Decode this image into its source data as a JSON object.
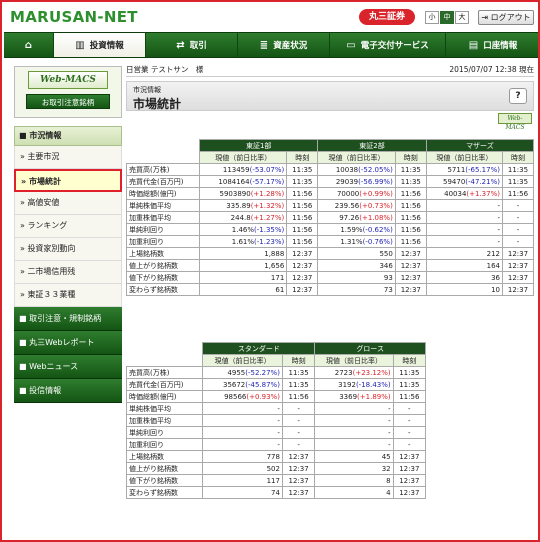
{
  "header": {
    "logo": "MARUSAN-NET",
    "brand": "丸三証券",
    "font_sizes": [
      "小",
      "中",
      "大"
    ],
    "logout": "ログアウト"
  },
  "nav": [
    {
      "label": "",
      "icon": "home-icon"
    },
    {
      "label": "投資情報",
      "icon": "chart-icon"
    },
    {
      "label": "取引",
      "icon": "trade-arrows-icon"
    },
    {
      "label": "資産状況",
      "icon": "database-icon"
    },
    {
      "label": "電子交付サービス",
      "icon": "monitor-icon"
    },
    {
      "label": "口座情報",
      "icon": "account-icon"
    }
  ],
  "sidebar": {
    "webmacs_logo": "Web-MACS",
    "webmacs_button": "お取引注意銘柄",
    "section": "市況情報",
    "items": [
      "主要市況",
      "市場統計",
      "高値安値",
      "ランキング",
      "投資家別動向",
      "二市場信用残",
      "東証３３業種"
    ],
    "selected": "市場統計",
    "dark_items": [
      "取引注意・規制銘柄",
      "丸三Webレポート",
      "Webニュース",
      "投信情報"
    ]
  },
  "main": {
    "user_prefix": "日営業",
    "user_name": "テストサン　様",
    "datetime": "2015/07/07 12:38 現在",
    "title_sub": "市況情報",
    "title": "市場統計",
    "help": "?",
    "webmacs_small": "Web-MACS",
    "col_current": "現値（前日比率）",
    "col_time": "時刻"
  },
  "table1": {
    "groups": [
      "東証1部",
      "東証2部",
      "マザーズ"
    ],
    "rows": [
      {
        "label": "売買高(万株)",
        "cells": [
          [
            "113459",
            "(-53.07%)",
            "neg",
            "11:35"
          ],
          [
            "10038",
            "(-52.05%)",
            "neg",
            "11:35"
          ],
          [
            "5711",
            "(-65.17%)",
            "neg",
            "11:35"
          ]
        ]
      },
      {
        "label": "売買代金(百万円)",
        "cells": [
          [
            "1084164",
            "(-57.17%)",
            "neg",
            "11:35"
          ],
          [
            "29039",
            "(-56.99%)",
            "neg",
            "11:35"
          ],
          [
            "59470",
            "(-47.21%)",
            "neg",
            "11:35"
          ]
        ]
      },
      {
        "label": "時価総額(億円)",
        "cells": [
          [
            "5903890",
            "(+1.28%)",
            "pos",
            "11:56"
          ],
          [
            "70000",
            "(+0.99%)",
            "pos",
            "11:56"
          ],
          [
            "40034",
            "(+1.37%)",
            "pos",
            "11:56"
          ]
        ]
      },
      {
        "label": "単純株価平均",
        "cells": [
          [
            "335.89",
            "(+1.32%)",
            "pos",
            "11:56"
          ],
          [
            "239.56",
            "(+0.73%)",
            "pos",
            "11:56"
          ],
          [
            "-",
            "",
            "",
            "-"
          ]
        ]
      },
      {
        "label": "加重株価平均",
        "cells": [
          [
            "244.8",
            "(+1.27%)",
            "pos",
            "11:56"
          ],
          [
            "97.26",
            "(+1.08%)",
            "pos",
            "11:56"
          ],
          [
            "-",
            "",
            "",
            "-"
          ]
        ]
      },
      {
        "label": "単純利回り",
        "cells": [
          [
            "1.46%",
            "(-1.35%)",
            "neg",
            "11:56"
          ],
          [
            "1.59%",
            "(-0.62%)",
            "neg",
            "11:56"
          ],
          [
            "-",
            "",
            "",
            "-"
          ]
        ]
      },
      {
        "label": "加重利回り",
        "cells": [
          [
            "1.61%",
            "(-1.23%)",
            "neg",
            "11:56"
          ],
          [
            "1.31%",
            "(-0.76%)",
            "neg",
            "11:56"
          ],
          [
            "-",
            "",
            "",
            "-"
          ]
        ]
      },
      {
        "label": "上場銘柄数",
        "cells": [
          [
            "1,888",
            "",
            "",
            "12:37"
          ],
          [
            "550",
            "",
            "",
            "12:37"
          ],
          [
            "212",
            "",
            "",
            "12:37"
          ]
        ]
      },
      {
        "label": "値上がり銘柄数",
        "cells": [
          [
            "1,656",
            "",
            "",
            "12:37"
          ],
          [
            "346",
            "",
            "",
            "12:37"
          ],
          [
            "164",
            "",
            "",
            "12:37"
          ]
        ]
      },
      {
        "label": "値下がり銘柄数",
        "cells": [
          [
            "171",
            "",
            "",
            "12:37"
          ],
          [
            "93",
            "",
            "",
            "12:37"
          ],
          [
            "36",
            "",
            "",
            "12:37"
          ]
        ]
      },
      {
        "label": "変わらず銘柄数",
        "cells": [
          [
            "61",
            "",
            "",
            "12:37"
          ],
          [
            "73",
            "",
            "",
            "12:37"
          ],
          [
            "10",
            "",
            "",
            "12:37"
          ]
        ]
      }
    ]
  },
  "table2": {
    "groups": [
      "スタンダード",
      "グロース"
    ],
    "rows": [
      {
        "label": "売買高(万株)",
        "cells": [
          [
            "4955",
            "(-52.27%)",
            "neg",
            "11:35"
          ],
          [
            "2723",
            "(+23.12%)",
            "pos",
            "11:35"
          ]
        ]
      },
      {
        "label": "売買代金(百万円)",
        "cells": [
          [
            "35672",
            "(-45.87%)",
            "neg",
            "11:35"
          ],
          [
            "3192",
            "(-18.43%)",
            "neg",
            "11:35"
          ]
        ]
      },
      {
        "label": "時価総額(億円)",
        "cells": [
          [
            "98566",
            "(+0.93%)",
            "pos",
            "11:56"
          ],
          [
            "3369",
            "(+1.89%)",
            "pos",
            "11:56"
          ]
        ]
      },
      {
        "label": "単純株価平均",
        "cells": [
          [
            "-",
            "",
            "",
            "-"
          ],
          [
            "-",
            "",
            "",
            "-"
          ]
        ]
      },
      {
        "label": "加重株価平均",
        "cells": [
          [
            "-",
            "",
            "",
            "-"
          ],
          [
            "-",
            "",
            "",
            "-"
          ]
        ]
      },
      {
        "label": "単純利回り",
        "cells": [
          [
            "-",
            "",
            "",
            "-"
          ],
          [
            "-",
            "",
            "",
            "-"
          ]
        ]
      },
      {
        "label": "加重利回り",
        "cells": [
          [
            "-",
            "",
            "",
            "-"
          ],
          [
            "-",
            "",
            "",
            "-"
          ]
        ]
      },
      {
        "label": "上場銘柄数",
        "cells": [
          [
            "778",
            "",
            "",
            "12:37"
          ],
          [
            "45",
            "",
            "",
            "12:37"
          ]
        ]
      },
      {
        "label": "値上がり銘柄数",
        "cells": [
          [
            "502",
            "",
            "",
            "12:37"
          ],
          [
            "32",
            "",
            "",
            "12:37"
          ]
        ]
      },
      {
        "label": "値下がり銘柄数",
        "cells": [
          [
            "117",
            "",
            "",
            "12:37"
          ],
          [
            "8",
            "",
            "",
            "12:37"
          ]
        ]
      },
      {
        "label": "変わらず銘柄数",
        "cells": [
          [
            "74",
            "",
            "",
            "12:37"
          ],
          [
            "4",
            "",
            "",
            "12:37"
          ]
        ]
      }
    ]
  },
  "colors": {
    "accent": "#1e4f1e",
    "brand_red": "#d9242b",
    "negative": "#2326b8",
    "positive": "#d9242b"
  }
}
